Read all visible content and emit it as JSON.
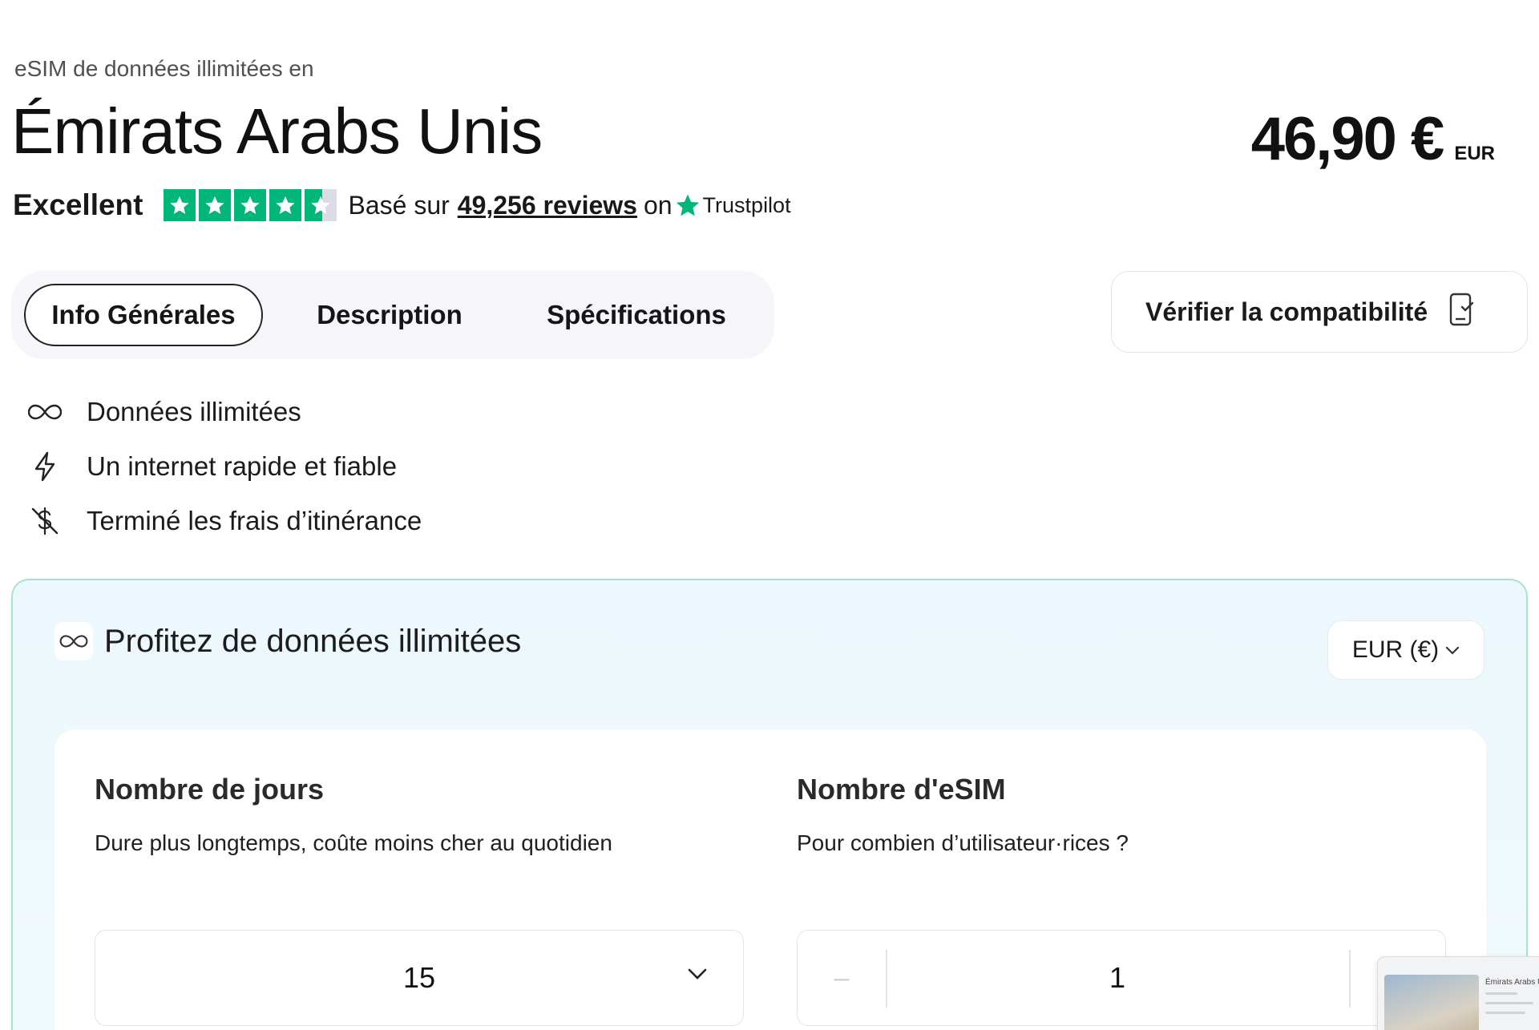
{
  "product": {
    "subtitle": "eSIM de données illimitées en",
    "title": "Émirats Arabs Unis",
    "price": "46,90 €",
    "currency_code": "EUR"
  },
  "rating": {
    "label": "Excellent",
    "stars": 4.5,
    "based_on": "Basé sur",
    "reviews_link": "49,256 reviews",
    "on": "on",
    "provider": "Trustpilot",
    "star_color": "#00b67a"
  },
  "tabs": [
    {
      "label": "Info Générales",
      "active": true
    },
    {
      "label": "Description",
      "active": false
    },
    {
      "label": "Spécifications",
      "active": false
    }
  ],
  "compat_button": {
    "label": "Vérifier la compatibilité",
    "icon": "phone-check-icon"
  },
  "features": [
    {
      "icon": "infinity-icon",
      "text": "Données illimitées"
    },
    {
      "icon": "lightning-icon",
      "text": "Un internet rapide et fiable"
    },
    {
      "icon": "no-dollar-icon",
      "text": "Terminé les frais d’itinérance"
    }
  ],
  "plan": {
    "title": "Profitez de données illimitées",
    "currency_select": "EUR (€)",
    "days": {
      "title": "Nombre de jours",
      "description": "Dure plus longtemps, coûte moins cher au quotidien",
      "value": "15"
    },
    "esims": {
      "title": "Nombre d'eSIM",
      "description": "Pour combien d’utilisateur·rices ?",
      "value": "1",
      "minus_label": "–"
    }
  },
  "thumbnail": {
    "caption": "Émirats Arabs U"
  },
  "colors": {
    "accent_green": "#00b67a",
    "panel_border": "#a6e5c3",
    "panel_bg": "#ecf8fd"
  }
}
